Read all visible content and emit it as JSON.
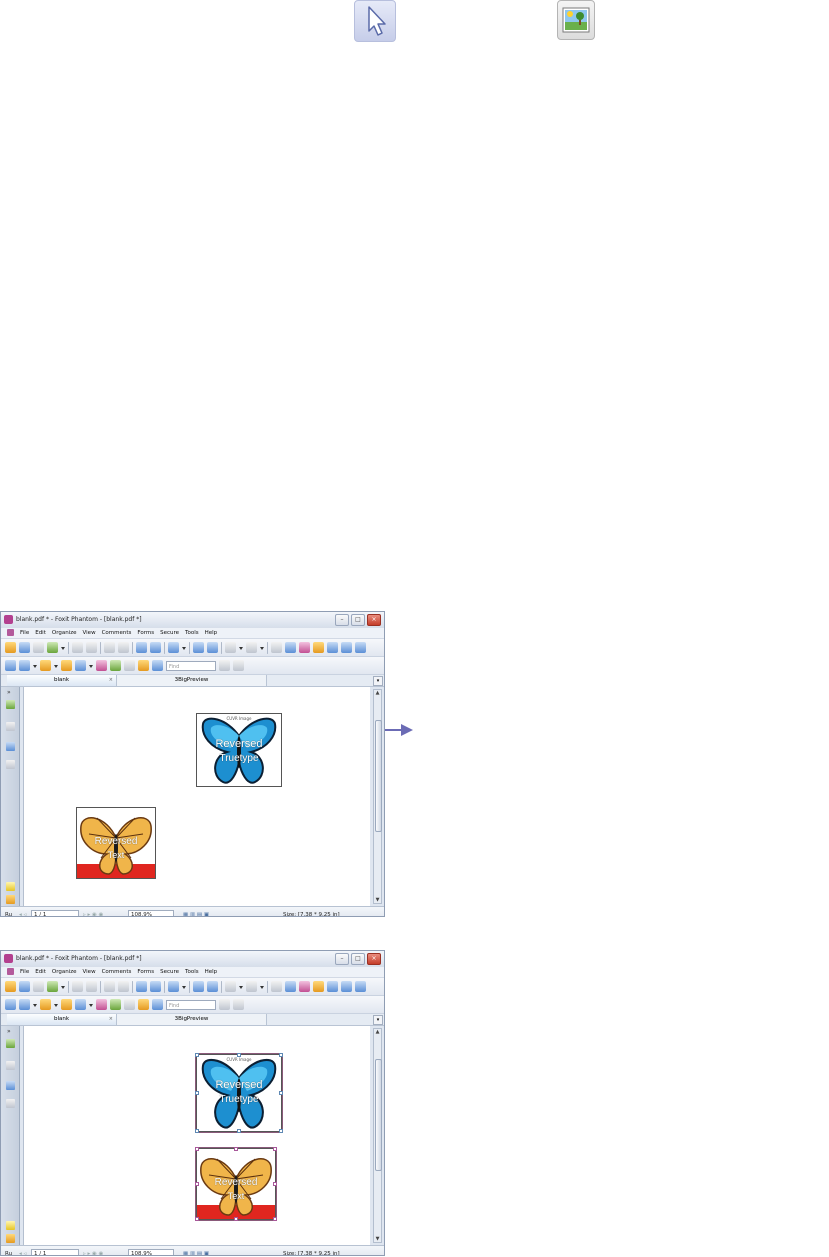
{
  "windows": [
    {
      "title": "blank.pdf * - Foxit Phantom - [blank.pdf *]",
      "menu": [
        "File",
        "Edit",
        "Organize",
        "View",
        "Comments",
        "Forms",
        "Secure",
        "Tools",
        "Help"
      ],
      "find_placeholder": "Find",
      "tabs": [
        {
          "label": "blank"
        },
        {
          "label": "3BigPreview"
        }
      ],
      "status": {
        "mode": "Ru",
        "page": "1 / 1",
        "zoom": "108.9%",
        "size": "Size: [7.38 * 9.25 in]"
      },
      "image_top": {
        "caption": "CUVR Image",
        "line1": "Reversed",
        "line2": "Truetype"
      },
      "image_bottom": {
        "caption": "",
        "line1": "Reversed",
        "line2": "Text"
      },
      "selected": false
    },
    {
      "title": "blank.pdf * - Foxit Phantom - [blank.pdf *]",
      "menu": [
        "File",
        "Edit",
        "Organize",
        "View",
        "Comments",
        "Forms",
        "Secure",
        "Tools",
        "Help"
      ],
      "find_placeholder": "Find",
      "tabs": [
        {
          "label": "blank"
        },
        {
          "label": "3BigPreview"
        }
      ],
      "status": {
        "mode": "Ru",
        "page": "1 / 1",
        "zoom": "108.9%",
        "size": "Size: [7.38 * 9.25 in]"
      },
      "image_top": {
        "caption": "CUVR Image",
        "line1": "Reversed",
        "line2": "Truetype"
      },
      "image_bottom": {
        "caption": "",
        "line1": "Reversed",
        "line2": "Text"
      },
      "selected": true
    }
  ],
  "icons": {
    "top_left": "select-cursor-icon",
    "top_right": "image-tool-icon"
  },
  "colors": {
    "arrow": "#6b6bb5",
    "accent": "#b3408f"
  }
}
